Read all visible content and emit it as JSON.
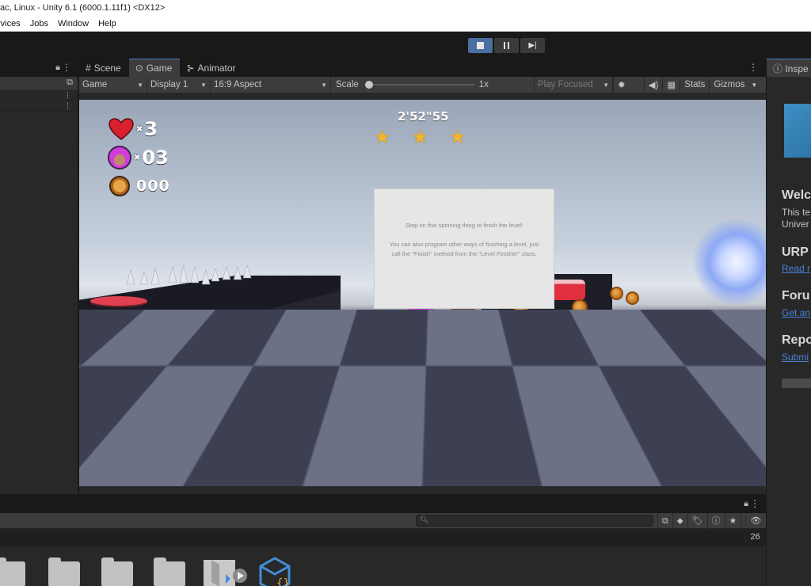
{
  "window": {
    "title": "ac, Linux - Unity 6.1 (6000.1.11f1) <DX12>"
  },
  "menu": [
    "rvices",
    "Jobs",
    "Window",
    "Help"
  ],
  "scene_tabs": [
    {
      "label": "Scene",
      "icon": "grid-icon"
    },
    {
      "label": "Game",
      "icon": "gamepad-icon",
      "active": true
    },
    {
      "label": "Animator",
      "icon": "animator-icon"
    }
  ],
  "game_toolbar": {
    "mode": "Game",
    "display": "Display 1",
    "aspect": "16:9 Aspect",
    "scale_label": "Scale",
    "scale_value": "1x",
    "play_mode": "Play Focused",
    "stats": "Stats",
    "gizmos": "Gizmos"
  },
  "hud": {
    "lives": "3",
    "characters": "03",
    "coins": "000",
    "timer": "2'52\"55",
    "stars_count": 3
  },
  "dialog": {
    "line1": "Step on this spinning thing to finish the level!",
    "line2": "You can also program other ways of finishing a level, just call the \"Finish\" method from the \"Level Finisher\" class."
  },
  "inspector": {
    "tab": "Inspe",
    "welcome_title": "Welco",
    "welcome_text1": "This te",
    "welcome_text2": "Univer",
    "urp_title": "URP",
    "urp_link": "Read r",
    "forum_title": "Foru",
    "forum_link": "Get an",
    "report_title": "Repo",
    "report_link": "Submi"
  },
  "project": {
    "count": "26"
  },
  "colors": {
    "accent": "#4f80c4",
    "link": "#4c7fd9",
    "star": "#f2b531",
    "heart": "#d8202f"
  }
}
